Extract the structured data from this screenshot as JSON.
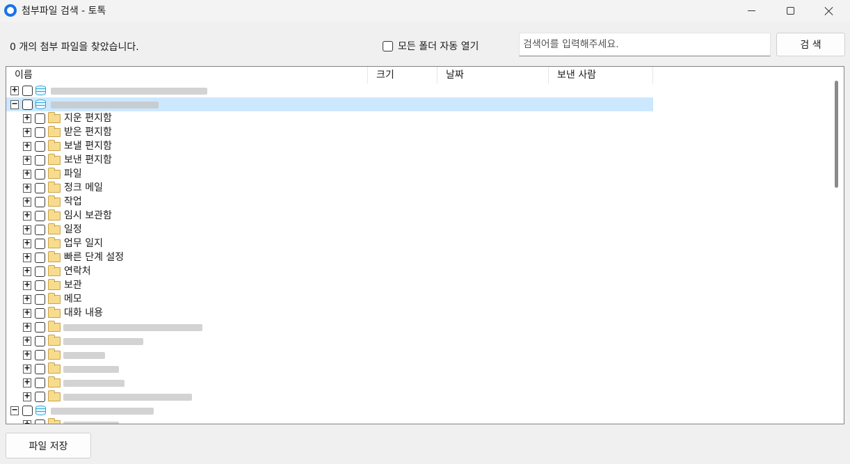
{
  "window": {
    "title": "첨부파일 검색 - 토톡",
    "controls": [
      "minimize",
      "maximize",
      "close"
    ]
  },
  "toolbar": {
    "found_text": "0 개의 첨부 파일을 찾았습니다.",
    "auto_open_label": "모든 폴더 자동 열기",
    "auto_open_checked": false,
    "search_placeholder": "검색어를 입력해주세요.",
    "search_value": "",
    "search_button": "검 색"
  },
  "tree": {
    "columns": [
      "이름",
      "크기",
      "날짜",
      "보낸 사람"
    ],
    "rows": [
      {
        "level": 0,
        "expander": "+",
        "icon": "database-icon",
        "label": "",
        "redacted": true,
        "width": 225
      },
      {
        "level": 0,
        "expander": "−",
        "icon": "database-icon",
        "label": "",
        "redacted": true,
        "width": 155,
        "selected": true
      },
      {
        "level": 1,
        "expander": "+",
        "icon": "folder-icon",
        "label": "지운 편지함"
      },
      {
        "level": 1,
        "expander": "+",
        "icon": "folder-icon",
        "label": "받은 편지함"
      },
      {
        "level": 1,
        "expander": "+",
        "icon": "folder-icon",
        "label": "보낼 편지함"
      },
      {
        "level": 1,
        "expander": "+",
        "icon": "folder-icon",
        "label": "보낸 편지함"
      },
      {
        "level": 1,
        "expander": "+",
        "icon": "folder-icon",
        "label": "파일"
      },
      {
        "level": 1,
        "expander": "+",
        "icon": "folder-icon",
        "label": "정크 메일"
      },
      {
        "level": 1,
        "expander": "+",
        "icon": "folder-icon",
        "label": "작업"
      },
      {
        "level": 1,
        "expander": "+",
        "icon": "folder-icon",
        "label": "임시 보관함"
      },
      {
        "level": 1,
        "expander": "+",
        "icon": "folder-icon",
        "label": "일정"
      },
      {
        "level": 1,
        "expander": "+",
        "icon": "folder-icon",
        "label": "업무 일지"
      },
      {
        "level": 1,
        "expander": "+",
        "icon": "folder-icon",
        "label": "빠른 단계 설정"
      },
      {
        "level": 1,
        "expander": "+",
        "icon": "folder-icon",
        "label": "연락처"
      },
      {
        "level": 1,
        "expander": "+",
        "icon": "folder-icon",
        "label": "보관"
      },
      {
        "level": 1,
        "expander": "+",
        "icon": "folder-icon",
        "label": "메모"
      },
      {
        "level": 1,
        "expander": "+",
        "icon": "folder-icon",
        "label": "대화 내용"
      },
      {
        "level": 1,
        "expander": "+",
        "icon": "folder-icon",
        "label": "",
        "redacted": true,
        "width": 200
      },
      {
        "level": 1,
        "expander": "+",
        "icon": "folder-icon",
        "label": "",
        "redacted": true,
        "width": 115
      },
      {
        "level": 1,
        "expander": "+",
        "icon": "folder-icon",
        "label": "",
        "redacted": true,
        "width": 60
      },
      {
        "level": 1,
        "expander": "+",
        "icon": "folder-icon",
        "label": "",
        "redacted": true,
        "width": 80
      },
      {
        "level": 1,
        "expander": "+",
        "icon": "folder-icon",
        "label": "",
        "redacted": true,
        "width": 88
      },
      {
        "level": 1,
        "expander": "+",
        "icon": "folder-icon",
        "label": "",
        "redacted": true,
        "width": 185
      },
      {
        "level": 0,
        "expander": "−",
        "icon": "database-icon",
        "label": "",
        "redacted": true,
        "width": 148
      },
      {
        "level": 1,
        "expander": "+",
        "icon": "folder-icon",
        "label": "",
        "redacted": true,
        "width": 80
      }
    ]
  },
  "footer": {
    "save_button": "파일 저장"
  }
}
